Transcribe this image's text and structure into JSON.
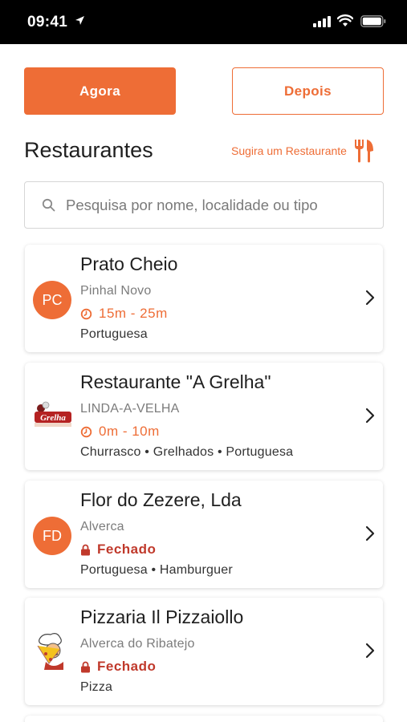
{
  "status_bar": {
    "time": "09:41"
  },
  "segment": {
    "now_label": "Agora",
    "later_label": "Depois"
  },
  "header": {
    "title": "Restaurantes",
    "suggest_label": "Sugira um Restaurante"
  },
  "search": {
    "placeholder": "Pesquisa por nome, localidade ou tipo",
    "value": ""
  },
  "colors": {
    "accent": "#ee6d36",
    "closed": "#c0392b"
  },
  "restaurants": [
    {
      "name": "Prato Cheio",
      "initials": "PC",
      "location": "Pinhal Novo",
      "status_type": "open",
      "status_text": "15m - 25m",
      "tags": "Portuguesa",
      "logo": "initials"
    },
    {
      "name": "Restaurante \"A Grelha\"",
      "location": "LINDA-A-VELHA",
      "status_type": "open",
      "status_text": "0m - 10m",
      "tags": "Churrasco • Grelhados • Portuguesa",
      "logo": "a-grelha-logo",
      "logo_text": "Grelha"
    },
    {
      "name": "Flor do Zezere, Lda",
      "initials": "FD",
      "location": "Alverca",
      "status_type": "closed",
      "status_text": "Fechado",
      "tags": "Portuguesa • Hamburguer",
      "logo": "initials"
    },
    {
      "name": "Pizzaria Il Pizzaiollo",
      "location": "Alverca do Ribatejo",
      "status_type": "closed",
      "status_text": "Fechado",
      "tags": "Pizza",
      "logo": "pizzaiollo-chef-logo"
    }
  ]
}
